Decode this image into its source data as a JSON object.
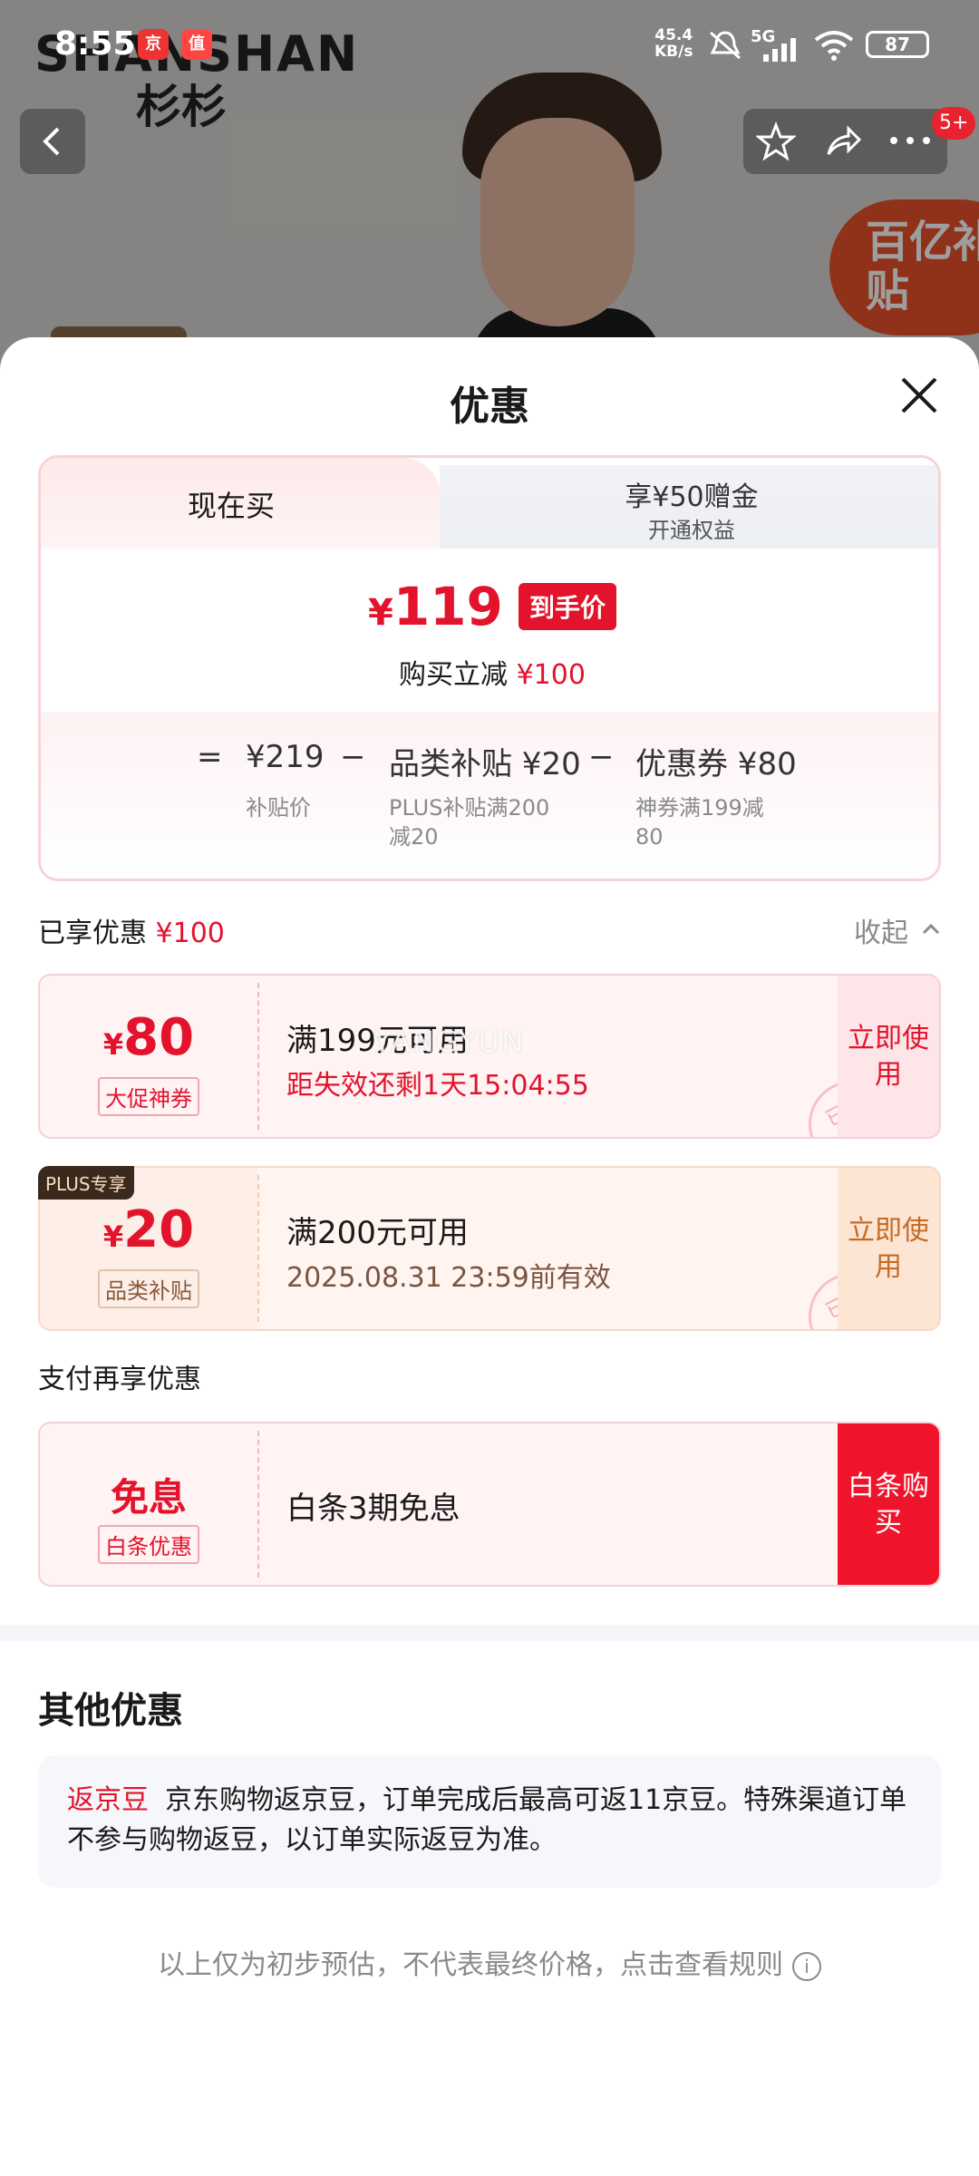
{
  "status_bar": {
    "time": "8:55",
    "net_speed_value": "45.4",
    "net_speed_unit": "KB/s",
    "signal": "5G",
    "battery": "87"
  },
  "product_bg": {
    "brand": "SHANSHAN",
    "brand_cn": "杉杉",
    "promo_badge": "百亿补贴",
    "more_badge": "5+"
  },
  "sheet": {
    "title": "优惠",
    "tabs": [
      {
        "label": "现在买"
      },
      {
        "label": "享¥50赠金",
        "sub": "开通权益"
      }
    ],
    "price": {
      "yen": "¥",
      "amount": "119",
      "tag": "到手价",
      "sub_label": "购买立减",
      "sub_amount": "¥100"
    },
    "formula": {
      "eq": "=",
      "minus": "−",
      "items": [
        {
          "value": "¥219",
          "note": "补贴价"
        },
        {
          "value": "品类补贴 ¥20",
          "note": "PLUS补贴满200减20"
        },
        {
          "value": "优惠券 ¥80",
          "note": "神券满199减80"
        }
      ]
    },
    "applied": {
      "label": "已享优惠",
      "amount": "¥100",
      "collapse": "收起"
    },
    "coupons": [
      {
        "yen": "¥",
        "amount": "80",
        "type": "大促神券",
        "condition": "满199元可用",
        "expire": "距失效还剩1天15:04:55",
        "action": "立即使用",
        "stamp": "已领"
      },
      {
        "yen": "¥",
        "amount": "20",
        "type": "品类补贴",
        "condition": "满200元可用",
        "expire": "2025.08.31 23:59前有效",
        "action": "立即使用",
        "stamp": "已领",
        "tag": "PLUS专享"
      }
    ],
    "watermark": "YANGYUN",
    "pay": {
      "heading": "支付再享优惠",
      "label": "免息",
      "type": "白条优惠",
      "condition": "白条3期免息",
      "action": "白条购买"
    },
    "other": {
      "title": "其他优惠",
      "tag": "返京豆",
      "text": "京东购物返京豆，订单完成后最高可返11京豆。特殊渠道订单不参与购物返豆，以订单实际返豆为准。"
    },
    "footer": "以上仅为初步预估，不代表最终价格，点击查看规则",
    "footer_icon": "i"
  },
  "colors": {
    "accent_red": "#e3132c",
    "plus_dark": "#3a2a1e"
  }
}
